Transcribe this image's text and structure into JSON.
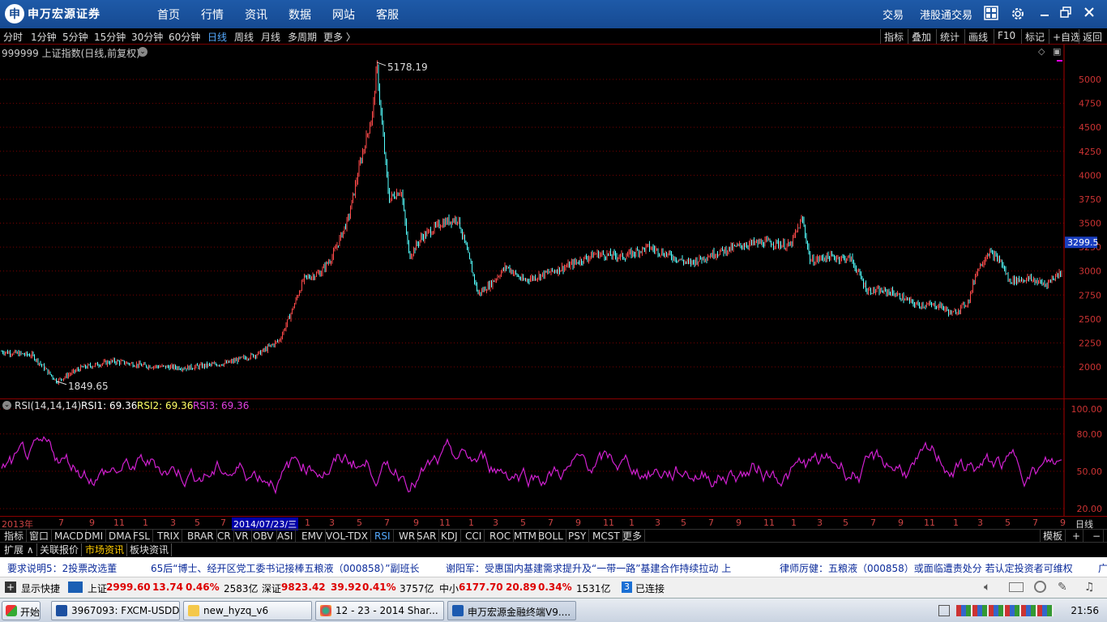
{
  "app": {
    "brand_mark": "申",
    "brand": "申万宏源证券",
    "nav": [
      "首页",
      "行情",
      "资讯",
      "数据",
      "网站",
      "客服"
    ],
    "right_links": [
      "交易",
      "港股通交易"
    ]
  },
  "periods": [
    "分时",
    "1分钟",
    "5分钟",
    "15分钟",
    "30分钟",
    "60分钟",
    "日线",
    "周线",
    "月线",
    "多周期",
    "更多 〉"
  ],
  "active_period": "日线",
  "right_tools": [
    "指标",
    "叠加",
    "统计",
    "画线",
    "F10",
    "标记",
    "+自选",
    "返回"
  ],
  "main_chart": {
    "title": "999999 上证指数(日线,前复权)",
    "y_ticks": [
      "5000",
      "4750",
      "4500",
      "4250",
      "4000",
      "3750",
      "3500",
      "3250",
      "3000",
      "2750",
      "2500",
      "2250",
      "2000"
    ],
    "current_price": "3299.5",
    "high_label": "5178.19",
    "low_label": "1849.65"
  },
  "rsi": {
    "name": "RSI(14,14,14)",
    "rsi1": "RSI1: 69.36",
    "rsi2": "RSI2: 69.36",
    "rsi3": "RSI3: 69.36",
    "y_ticks": [
      "100.00",
      "80.00",
      "50.00",
      "20.00"
    ]
  },
  "time_axis": {
    "first": "2013年",
    "selected": "2014/07/23/三",
    "period": "日线",
    "ticks": [
      "7",
      "9",
      "11",
      "1",
      "3",
      "5",
      "7",
      "1",
      "3",
      "5",
      "7",
      "9",
      "11",
      "1",
      "3",
      "5",
      "7",
      "9",
      "11",
      "1",
      "3",
      "5",
      "7",
      "9",
      "11",
      "1",
      "3",
      "5",
      "7",
      "9",
      "11",
      "1",
      "3",
      "5",
      "7",
      "9"
    ]
  },
  "indicator_tabs": [
    "指标",
    "窗口",
    "MACD",
    "DMI",
    "DMA",
    "FSL",
    "TRIX",
    "BRAR",
    "CR",
    "VR",
    "OBV",
    "ASI",
    "EMV",
    "VOL-TDX",
    "RSI",
    "WR",
    "SAR",
    "KDJ",
    "CCI",
    "ROC",
    "MTM",
    "BOLL",
    "PSY",
    "MCST",
    "更多"
  ],
  "active_indicator": "RSI",
  "template_tab": "模板",
  "bottom_tabs": [
    "扩展 ∧",
    "关联报价",
    "市场资讯",
    "板块资讯"
  ],
  "active_bottom_tab": "市场资讯",
  "news": [
    "要求说明5：2投票改选董",
    "65后“博士、经开区党工委书记接棒五粮液（000858）”副班长",
    "谢阳军：受惠国内基建需求提升及“一带一路”基建合作持续拉动 上",
    "律师厉健：五粮液（000858）或面临遭责处分 若认定投资者可维权",
    "广"
  ],
  "status": {
    "shortcut": "显示快捷",
    "sh_label": "上证",
    "sh_value": "2999.60",
    "sh_change": "13.74",
    "sh_pct": "0.46%",
    "sh_volume": "2583亿",
    "sz_label": "深证",
    "sz_value": "9823.42",
    "sz_change": "39.92",
    "sz_pct": "0.41%",
    "sz_volume": "3757亿",
    "zx_label": "中小",
    "zx_value": "6177.70",
    "zx_change": "20.89",
    "zx_pct": "0.34%",
    "zx_volume": "1531亿",
    "connections": "3",
    "connected": "已连接"
  },
  "taskbar": {
    "start": "开始",
    "buttons": [
      "3967093: FXCM-USDDe...",
      "new_hyzq_v6",
      "12 - 23 - 2014 Shar...",
      "申万宏源金融终端V9...."
    ],
    "clock": "21:56"
  },
  "colors": {
    "up": "#ff4a4a",
    "down": "#54ffff",
    "rsi": "#d020d0",
    "grid": "#7a0000",
    "accent": "#164a92"
  }
}
